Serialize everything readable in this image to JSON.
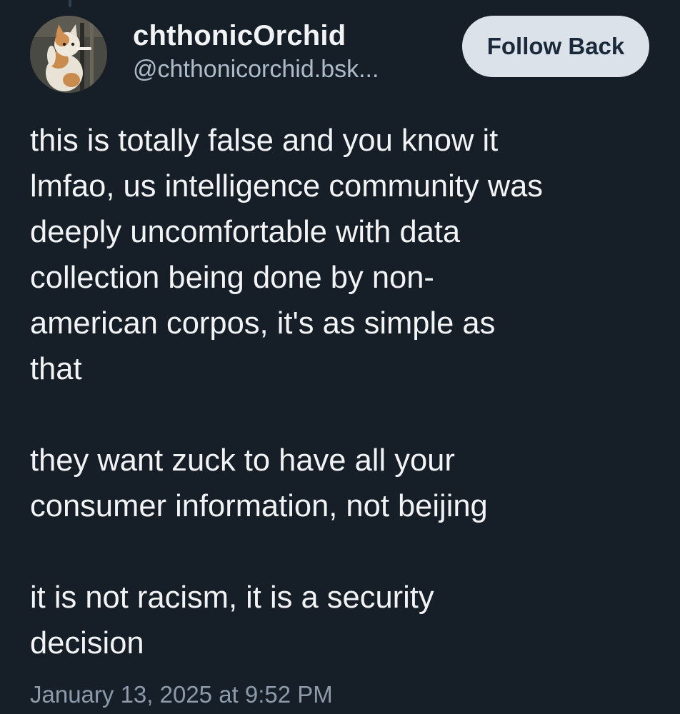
{
  "post": {
    "author": {
      "display_name": "chthonicOrchid",
      "handle": "@chthonicorchid.bsk...",
      "avatar_icon": "cat-avatar-icon"
    },
    "follow_button_label": "Follow Back",
    "paragraphs": [
      "this is totally false and you know it\nlmfao, us intelligence community was\ndeeply uncomfortable with data\ncollection being done by non-\namerican corpos, it's as simple as\nthat",
      "they want zuck to have all your\nconsumer information, not beijing",
      "it is not racism, it is a security\ndecision"
    ],
    "timestamp": "January 13, 2025 at 9:52 PM"
  },
  "colors": {
    "background": "#161e27",
    "text_primary": "#f1f3f5",
    "text_secondary": "#aebbc9",
    "button_bg": "#dce2ea",
    "button_text": "#1b2a3a"
  }
}
